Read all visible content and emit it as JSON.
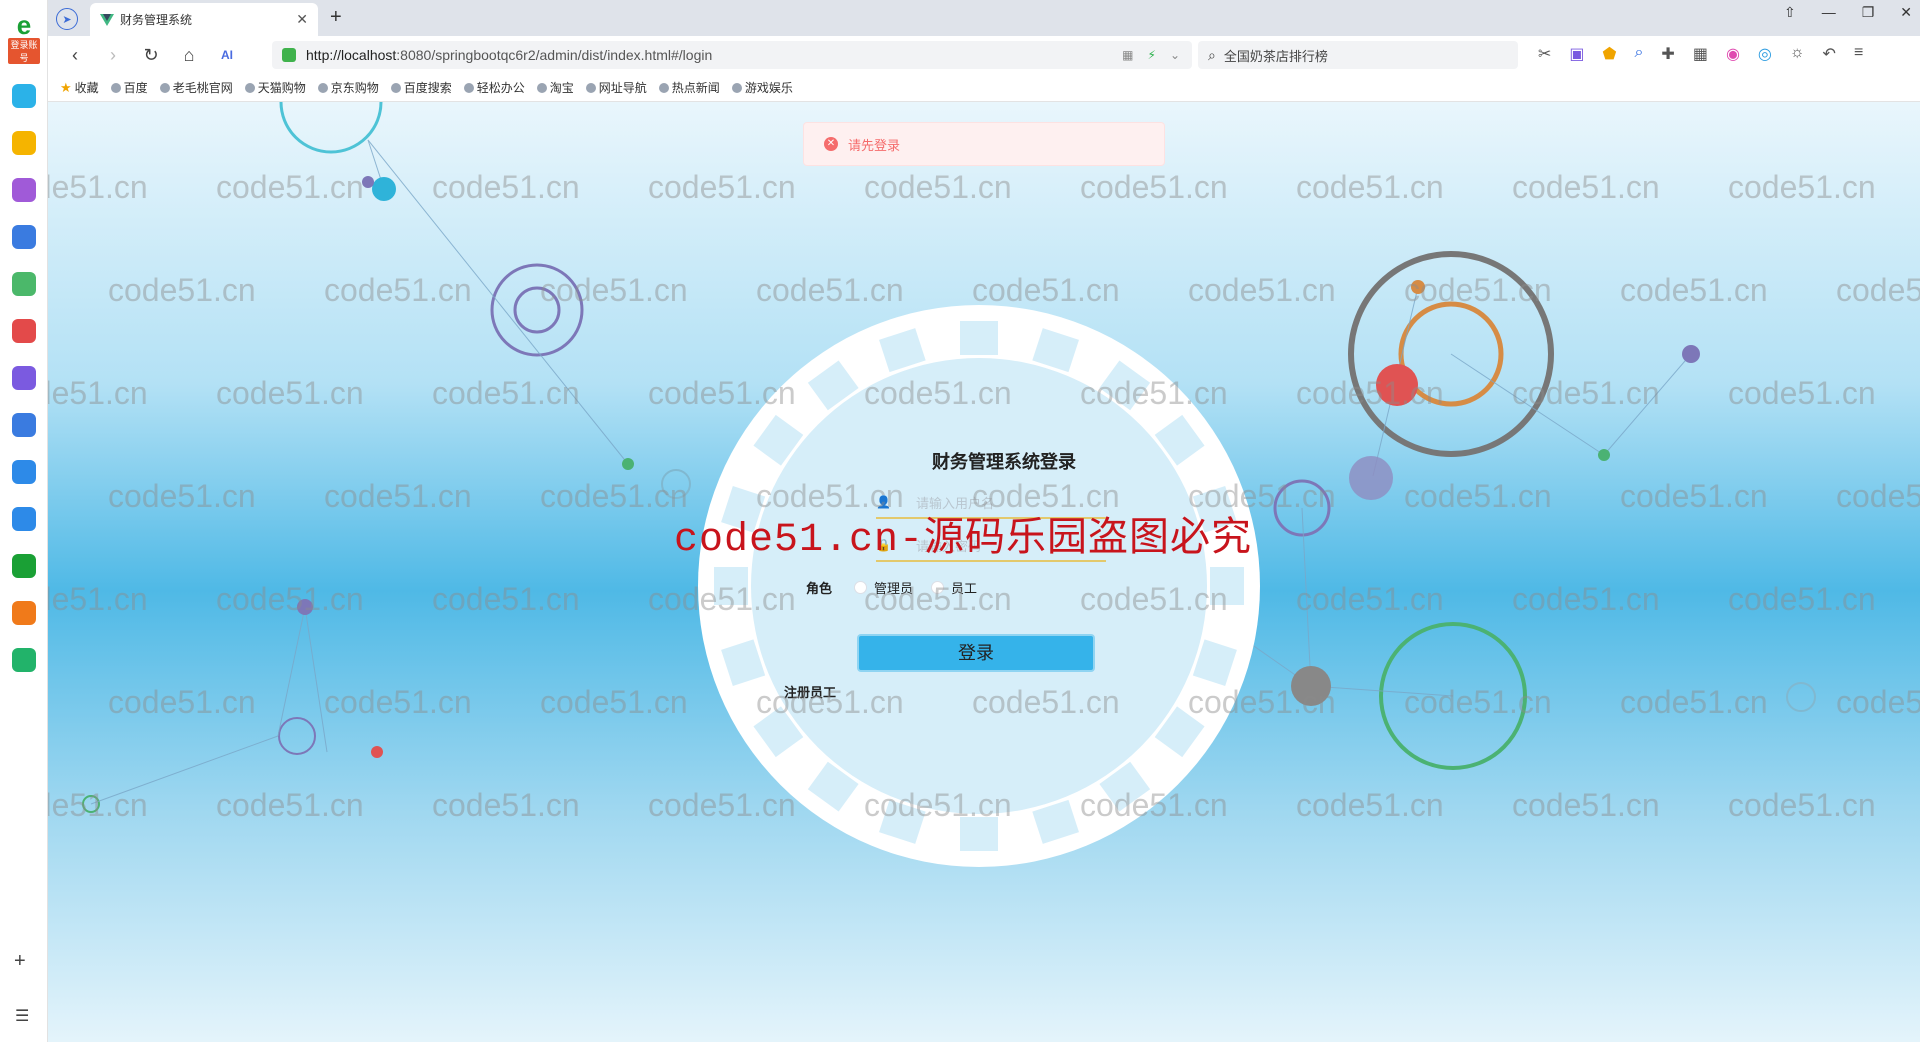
{
  "browser": {
    "tab_title": "财务管理系统",
    "new_tab_symbol": "+",
    "url_host": "http://localhost",
    "url_path": ":8080/springbootqc6r2/admin/dist/index.html#/login",
    "search_text": "全国奶茶店排行榜",
    "bookmarks": [
      "收藏",
      "百度",
      "老毛桃官网",
      "天猫购物",
      "京东购物",
      "百度搜索",
      "轻松办公",
      "淘宝",
      "网址导航",
      "热点新闻",
      "游戏娱乐"
    ]
  },
  "sidebar": {
    "badge": "登录账号",
    "icon_colors": [
      "#2bb2e8",
      "#f5b400",
      "#a05ad8",
      "#3a7be0",
      "#4bb86a",
      "#e34a4a",
      "#7b5ae0",
      "#3a7be0",
      "#2d8ae8",
      "#2d8ae8",
      "#1aa035",
      "#f07a1a",
      "#22b36a"
    ]
  },
  "toast": {
    "message": "请先登录"
  },
  "login": {
    "title": "财务管理系统登录",
    "username_placeholder": "请输入用户名",
    "password_placeholder": "请输入密码",
    "role_label": "角色",
    "roles": [
      "管理员",
      "员工"
    ],
    "submit_label": "登录",
    "register_label": "注册员工"
  },
  "watermark": {
    "text": "code51.cn",
    "banner": "code51.cn-源码乐园盗图必究"
  }
}
